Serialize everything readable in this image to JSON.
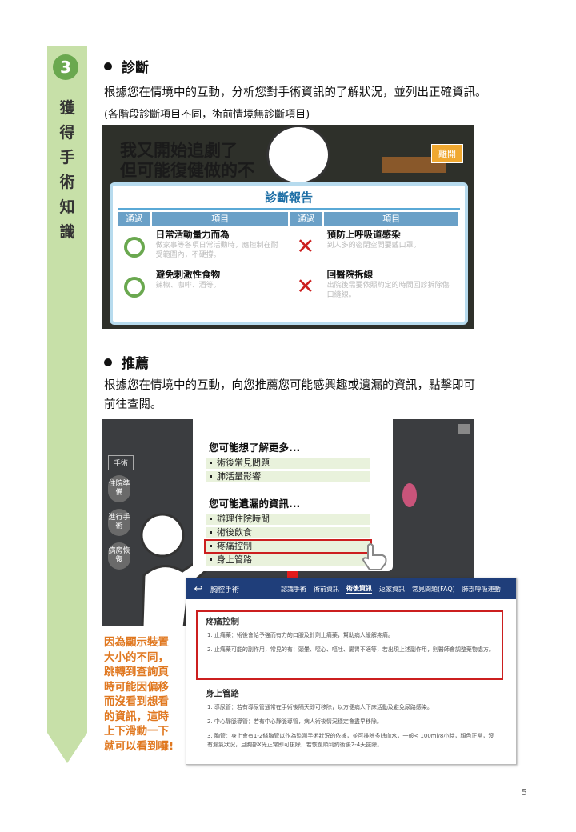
{
  "sidebar": {
    "number": "3",
    "title_chars": [
      "獲",
      "得",
      "手",
      "術",
      "知",
      "識"
    ]
  },
  "section1": {
    "heading": "診斷",
    "text": "根據您在情境中的互動，分析您對手術資訊的了解狀況，並列出正確資訊。",
    "subtext": "(各階段診斷項目不同，術前情境無診斷項目)"
  },
  "scene1": {
    "line1": "我又開始追劇了",
    "line2": "但可能復健做的不",
    "leave_button": "離開",
    "report_title": "診斷報告",
    "col_pass": "通過",
    "col_item": "項目",
    "rows": [
      {
        "left": {
          "title": "日常活動量力而為",
          "desc": "做家事等各項日常活動時，應控制在耐受範圍內，不硬撐。"
        },
        "right": {
          "title": "預防上呼吸道感染",
          "desc": "到人多的密閉空間要戴口罩。"
        }
      },
      {
        "left": {
          "title": "避免刺激性食物",
          "desc": "辣椒、咖啡、酒等。"
        },
        "right": {
          "title": "回醫院拆線",
          "desc": "出院後需要依照約定的時間回診拆除傷口縫線。"
        }
      }
    ]
  },
  "section2": {
    "heading": "推薦",
    "text_line1": "根據您在情境中的互動，向您推薦您可能感興趣或遺漏的資訊，點擊即可",
    "text_line2": "前往查閱。"
  },
  "scene2": {
    "nav_header": "手術",
    "nav_pills": [
      "住院準備",
      "進行手術",
      "病房恢復"
    ],
    "more_heading": "您可能想了解更多...",
    "more_links": [
      "術後常見問題",
      "肺活量影響"
    ],
    "missed_heading": "您可能遺漏的資訊...",
    "missed_links": [
      "辦理住院時間",
      "術後飲食",
      "疼痛控制",
      "身上管路"
    ]
  },
  "screenshot": {
    "title": "胸腔手術",
    "tabs": [
      "認識手術",
      "術前資訊",
      "術後資訊",
      "返家資訊",
      "常見問題(FAQ)",
      "肺部呼吸運動"
    ],
    "pain_title": "疼痛控制",
    "pain_items": [
      "1.  止痛藥：術後會給予強而有力的口服及針劑止痛藥，幫助病人緩解疼痛。",
      "2.  止痛藥可能的副作用，常見的有：頭暈、噁心、嘔吐、腸胃不適等，若出現上述副作用，則醫師會調整藥物處方。"
    ],
    "tube_title": "身上管路",
    "tube_items": [
      "1.  導尿管：若有導尿管通常在手術後隔天即可移除，以方便病人下床活動及避免尿路感染。",
      "2.  中心靜脈導管：若有中心靜脈導管，病人術後情況穩定會盡早移除。",
      "3.  胸管：身上會有1-2條胸管以作為監測手術狀況的依據，並可排除多餘血水，一般< 100ml/8小時，顏色正常，沒有漏氣狀況，且胸部X光正常即可拔除，若恢復順利約術後2-4天拔除。"
    ]
  },
  "note": "因為顯示裝置大小的不同，跳轉到查詢頁時可能因偏移而沒看到想看的資訊，這時上下滑動一下就可以看到囉!",
  "page_number": "5",
  "colors": {
    "sidebar": "#c7e0a8",
    "accent_green": "#6aa84f",
    "red": "#cc1f1f",
    "note_orange": "#e07820"
  }
}
